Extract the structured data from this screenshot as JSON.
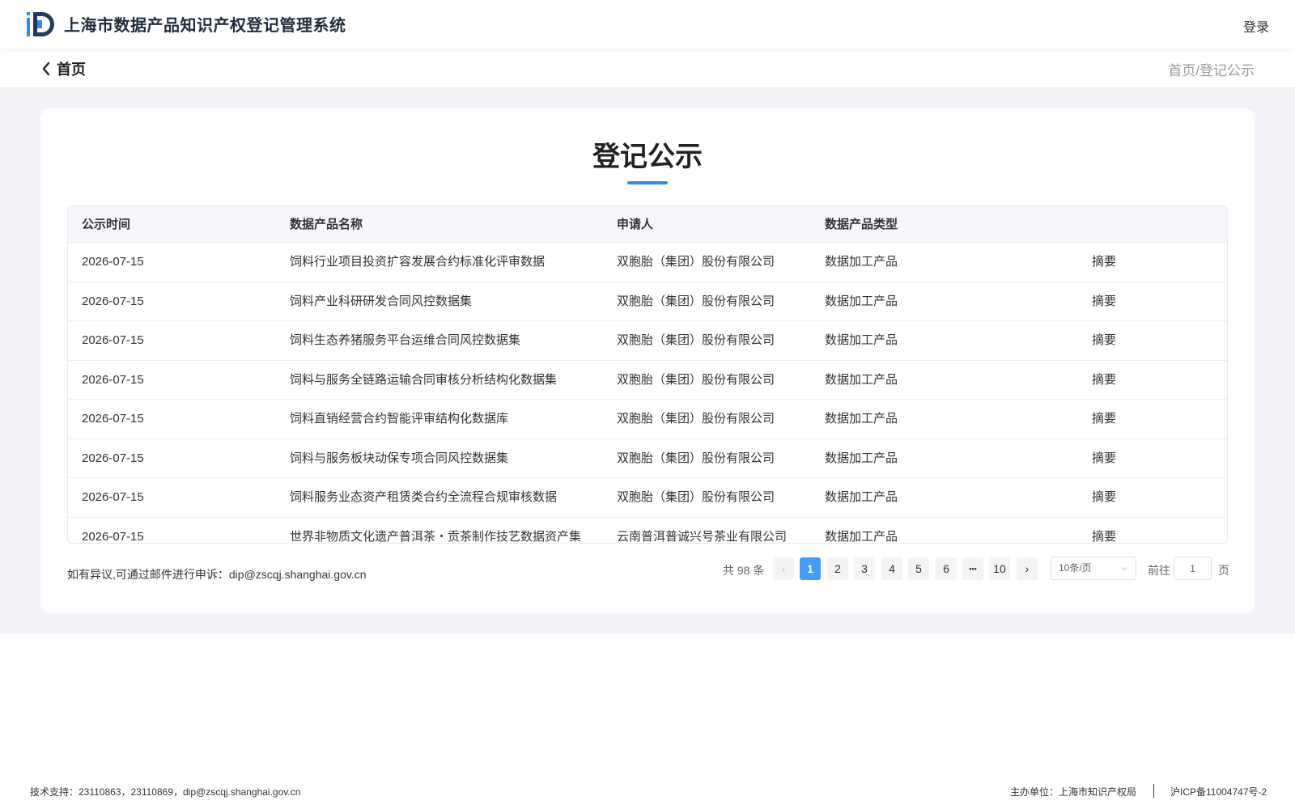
{
  "header": {
    "system_title": "上海市数据产品知识产权登记管理系统",
    "login_label": "登录"
  },
  "subnav": {
    "back_label": "首页",
    "breadcrumb": "首页/登记公示"
  },
  "main": {
    "title": "登记公示",
    "table": {
      "headers": [
        "公示时间",
        "数据产品名称",
        "申请人",
        "数据产品类型",
        ""
      ],
      "rows": [
        {
          "date": "2026-07-15",
          "name": "饲料行业项目投资扩容发展合约标准化评审数据",
          "applicant": "双胞胎（集团）股份有限公司",
          "type": "数据加工产品",
          "action": "摘要"
        },
        {
          "date": "2026-07-15",
          "name": "饲料产业科研研发合同风控数据集",
          "applicant": "双胞胎（集团）股份有限公司",
          "type": "数据加工产品",
          "action": "摘要"
        },
        {
          "date": "2026-07-15",
          "name": "饲料生态养猪服务平台运维合同风控数据集",
          "applicant": "双胞胎（集团）股份有限公司",
          "type": "数据加工产品",
          "action": "摘要"
        },
        {
          "date": "2026-07-15",
          "name": "饲料与服务全链路运输合同审核分析结构化数据集",
          "applicant": "双胞胎（集团）股份有限公司",
          "type": "数据加工产品",
          "action": "摘要"
        },
        {
          "date": "2026-07-15",
          "name": "饲料直销经营合约智能评审结构化数据库",
          "applicant": "双胞胎（集团）股份有限公司",
          "type": "数据加工产品",
          "action": "摘要"
        },
        {
          "date": "2026-07-15",
          "name": "饲料与服务板块动保专项合同风控数据集",
          "applicant": "双胞胎（集团）股份有限公司",
          "type": "数据加工产品",
          "action": "摘要"
        },
        {
          "date": "2026-07-15",
          "name": "饲料服务业态资产租赁类合约全流程合规审核数据",
          "applicant": "双胞胎（集团）股份有限公司",
          "type": "数据加工产品",
          "action": "摘要"
        },
        {
          "date": "2026-07-15",
          "name": "世界非物质文化遗产普洱茶・贡茶制作技艺数据资产集",
          "applicant": "云南普洱普诚兴号茶业有限公司",
          "type": "数据加工产品",
          "action": "摘要"
        }
      ]
    },
    "complaint_note": "如有异议,可通过邮件进行申诉：dip@zscqj.shanghai.gov.cn",
    "pagination": {
      "total_text": "共 98 条",
      "prev": "‹",
      "pages": [
        "1",
        "2",
        "3",
        "4",
        "5",
        "6"
      ],
      "ellipsis": "•••",
      "last_page": "10",
      "next": "›",
      "current": 1,
      "page_size": "10条/页",
      "goto_label": "前往",
      "goto_value": "1",
      "goto_unit": "页"
    }
  },
  "footer": {
    "tech_support": "技术支持：23110863，23110869，dip@zscqj.shanghai.gov.cn",
    "host": "主办单位：上海市知识产权局",
    "icp": "沪ICP备11004747号-2"
  },
  "colors": {
    "brand_blue": "#2d8cf0",
    "page_active": "#409eff",
    "background": "#f3f4f7"
  }
}
